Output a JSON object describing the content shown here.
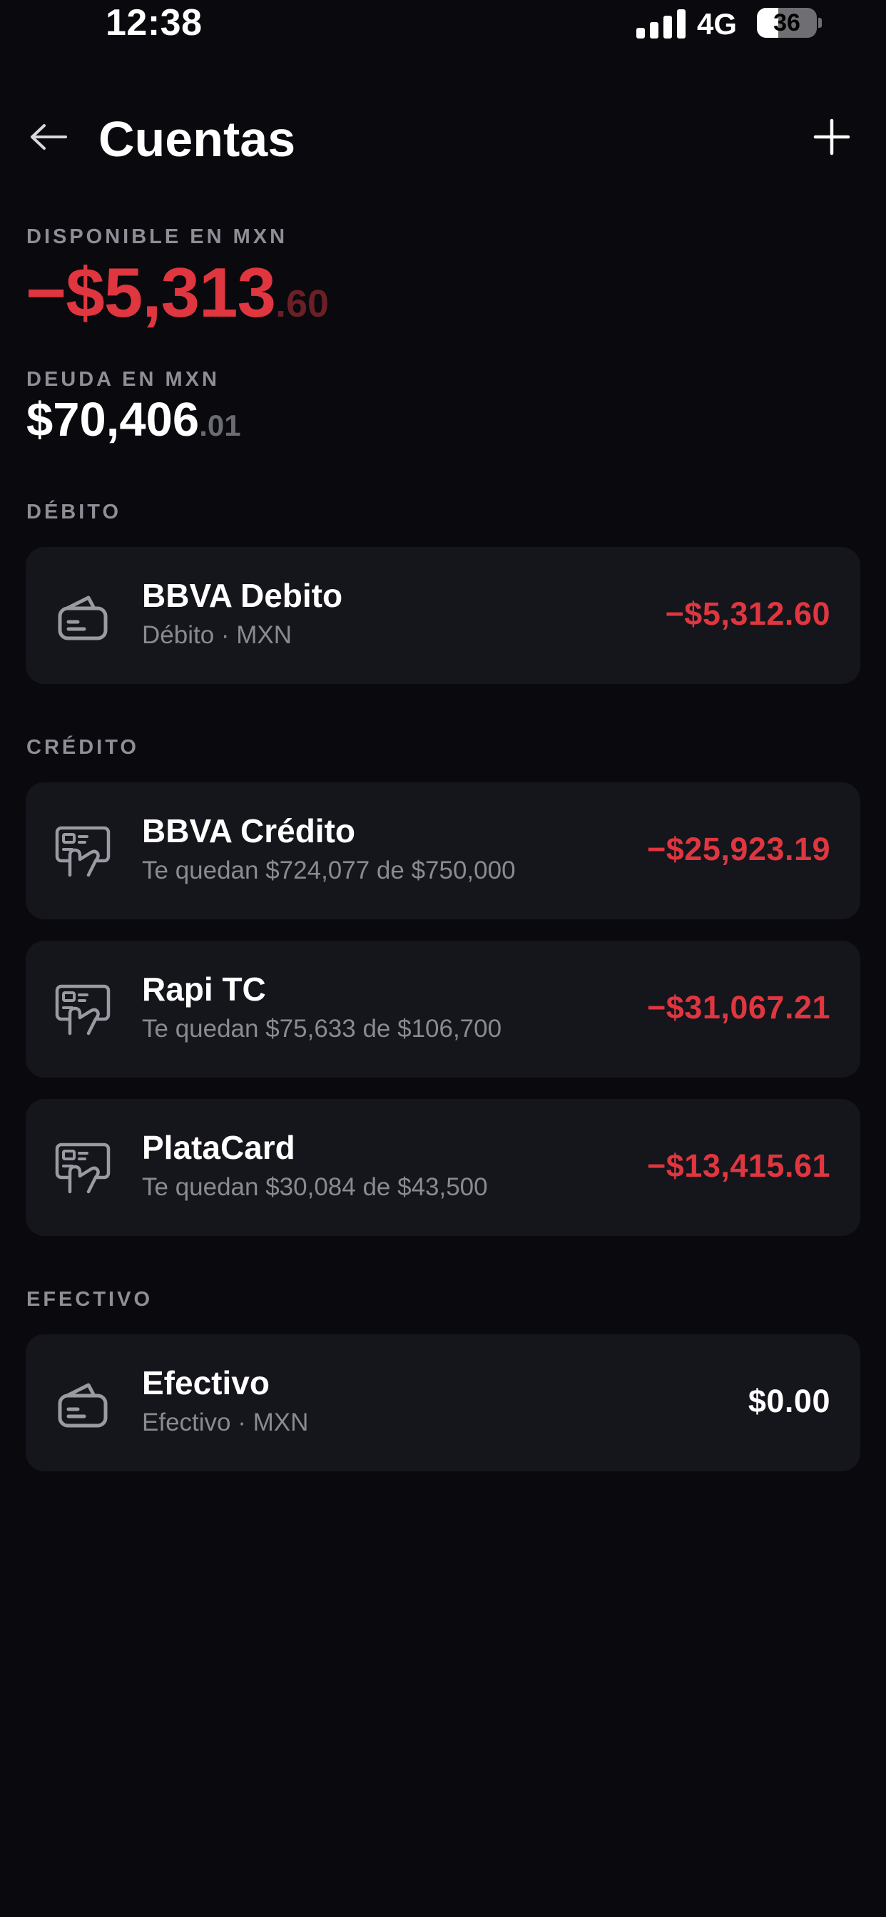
{
  "status_bar": {
    "time": "12:38",
    "network": "4G",
    "battery_level": 36,
    "battery_percent_fill": 0.36
  },
  "header": {
    "title": "Cuentas",
    "back_icon": "arrow-left-icon",
    "add_icon": "plus-icon"
  },
  "summary": {
    "available_label": "DISPONIBLE EN MXN",
    "available_int": "−$5,313",
    "available_dec": ".60",
    "debt_label": "DEUDA EN MXN",
    "debt_int": "$70,406",
    "debt_dec": ".01"
  },
  "sections": {
    "debit": {
      "label": "DÉBITO",
      "accounts": [
        {
          "name": "BBVA Debito",
          "subtitle": "Débito · MXN",
          "amount": "−$5,312.60",
          "icon": "wallet-icon",
          "negative": true
        }
      ]
    },
    "credit": {
      "label": "CRÉDITO",
      "accounts": [
        {
          "name": "BBVA Crédito",
          "subtitle": "Te quedan $724,077 de $750,000",
          "amount": "−$25,923.19",
          "icon": "credit-card-hand-icon",
          "negative": true
        },
        {
          "name": "Rapi TC",
          "subtitle": "Te quedan $75,633 de $106,700",
          "amount": "−$31,067.21",
          "icon": "credit-card-hand-icon",
          "negative": true
        },
        {
          "name": "PlataCard",
          "subtitle": "Te quedan $30,084 de $43,500",
          "amount": "−$13,415.61",
          "icon": "credit-card-hand-icon",
          "negative": true
        }
      ]
    },
    "cash": {
      "label": "EFECTIVO",
      "accounts": [
        {
          "name": "Efectivo",
          "subtitle": "Efectivo · MXN",
          "amount": "$0.00",
          "icon": "wallet-icon",
          "negative": false
        }
      ]
    }
  },
  "colors": {
    "background": "#09090e",
    "card": "#15151c",
    "negative": "#e0363f",
    "muted": "#8e8e96"
  }
}
